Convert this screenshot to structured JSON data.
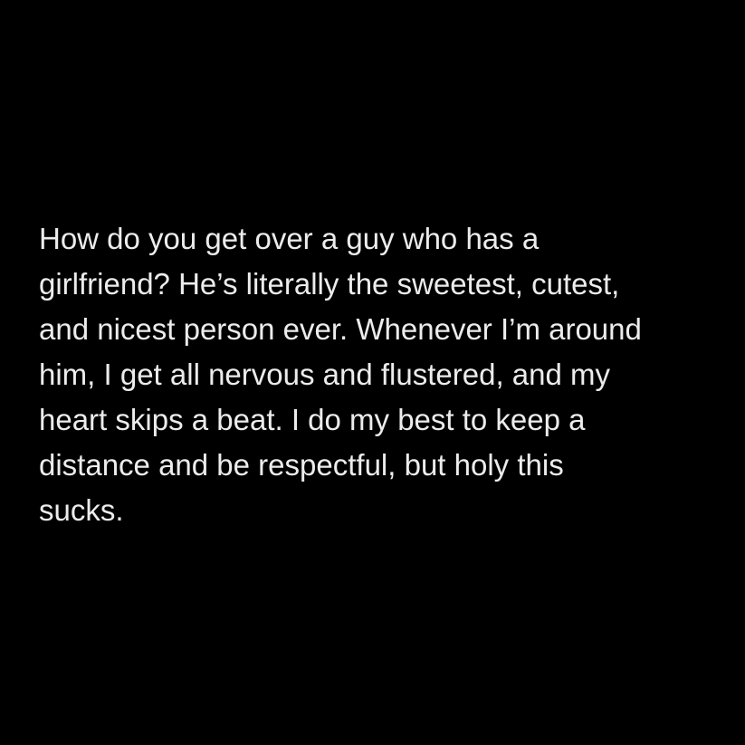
{
  "colors": {
    "background": "#000000",
    "text": "#ececec"
  },
  "post": {
    "lines": [
      "How do you get over a guy who has a",
      "girlfriend? He’s literally the sweetest, cutest,",
      "and nicest person ever. Whenever I’m around",
      "him, I get all nervous and flustered, and my",
      "heart skips a beat. I do my best to keep a",
      "distance and be respectful, but holy this",
      "sucks."
    ]
  }
}
